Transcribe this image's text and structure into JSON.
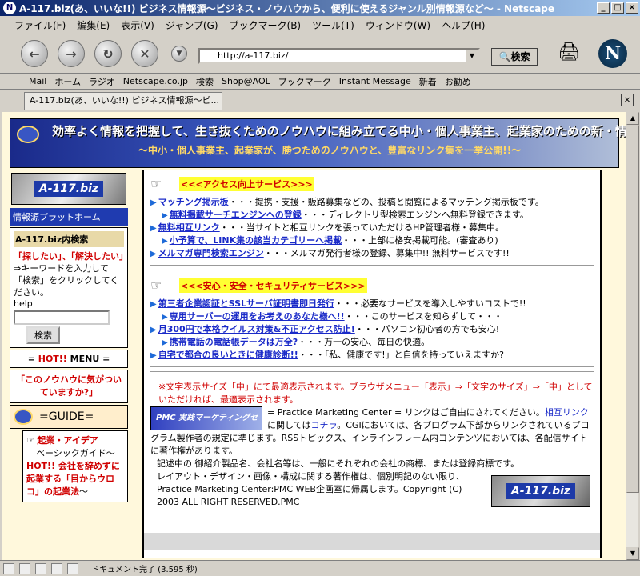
{
  "window": {
    "title": "A-117.biz(あ、いいな!!) ビジネス情報源～ビジネス・ノウハウから、便利に使えるジャンル別情報源など～ - Netscape",
    "app_icon": "N"
  },
  "menu": [
    "ファイル(F)",
    "編集(E)",
    "表示(V)",
    "ジャンプ(G)",
    "ブックマーク(B)",
    "ツール(T)",
    "ウィンドウ(W)",
    "ヘルプ(H)"
  ],
  "nav": {
    "url": "http://a-117.biz/",
    "search_label": "検索"
  },
  "bookmarks": [
    "Mail",
    "ホーム",
    "ラジオ",
    "Netscape.co.jp",
    "検索",
    "Shop@AOL",
    "ブックマーク",
    "Instant Message",
    "新着",
    "お勧め"
  ],
  "tab": {
    "label": "A-117.biz(あ、いいな!!) ビジネス情報源～ビ..."
  },
  "banner": {
    "line1": "効率よく情報を把握して、生き抜くためのノウハウに組み立てる中小・個人事業主、起業家のための新・情報入手ガイド",
    "line2": "～中小・個人事業主、起業家が、勝つためのノウハウと、豊富なリンク集を一挙公開!!～"
  },
  "sidebar": {
    "logo": "A-117.biz",
    "header": "情報源プラットホーム",
    "search_title": "A-117.biz内検索",
    "search_red": "「探したい」、「解決したい」",
    "search_desc": "⇒キーワードを入力して「検索」をクリックしてください。",
    "help": "help",
    "search_button": "検索",
    "hot_prefix": "= ",
    "hot_red": "HOT!!",
    "hot_rest": " MENU =",
    "notice": "「このノウハウに気がついていますか?」",
    "guide": "=GUIDE=",
    "kigyo_title": "起業・アイデア",
    "basic_guide": "ベーシックガイド～",
    "basic_hot": "HOT!! 会社を辞めずに起業する「目からウロコ」の起業法",
    "basic_tail": "～"
  },
  "sections": [
    {
      "title": "<<<アクセス向上サービス>>>",
      "items": [
        {
          "link": "マッチング掲示板",
          "desc": "・・・提携・支援・販路募集などの、投稿と閲覧によるマッチング掲示板です。",
          "indent": false
        },
        {
          "link": "無料掲載サーチエンジンへの登録",
          "desc": "・・・ディレクトリ型検索エンジンへ無料登録できます。",
          "indent": true
        },
        {
          "link": "無料相互リンク",
          "desc": "・・・当サイトと相互リンクを張っていただけるHP管理者様・募集中。",
          "indent": false
        },
        {
          "link": "小予算で、LINK集の該当カテゴリーへ掲載",
          "desc": "・・・上部に格安掲載可能。(審査あり)",
          "indent": true
        },
        {
          "link": "メルマガ専門検索エンジン",
          "desc": "・・・メルマガ発行者様の登録、募集中!! 無料サービスです!!",
          "indent": false
        }
      ]
    },
    {
      "title": "<<<安心・安全・セキュリティサービス>>>",
      "items": [
        {
          "link": "第三者企業認証とSSLサーバ証明書即日発行",
          "desc": "・・・必要なサービスを導入しやすいコストで!!",
          "indent": false
        },
        {
          "link": "専用サーバーの運用をお考えのあなた様へ!!",
          "desc": "・・・このサービスを知らずして・・・",
          "indent": true
        },
        {
          "link": "月300円で本格ウイルス対策&不正アクセス防止!",
          "desc": "・・・パソコン初心者の方でも安心!",
          "indent": false
        },
        {
          "link": "携帯電話の電話帳データは万全?",
          "desc": "・・・万一の安心、毎日の快適。",
          "indent": true
        },
        {
          "link": "自宅で都合の良いときに健康診断!!",
          "desc": "・・・「私、健康です!」と自信を持っていえますか?",
          "indent": false
        }
      ]
    }
  ],
  "footer": {
    "note": "※文字表示サイズ「中」にて最適表示されます。ブラウザメニュー「表示」⇒「文字のサイズ」⇒「中」としていただければ、最適表示されます。",
    "pmc_logo": "PMC 実践マーケティングセンター",
    "para1a": "= Practice Marketing Center = リンクはご自由にされてください。",
    "para1_link": "相互リンク",
    "para1b": "に関しては",
    "para1_link2": "コチラ",
    "para1c": "。CGIにおいては、各プログラム下部からリンクされているプログラム製作者の規定に準じます。RSSトピックス、インラインフレーム内コンテンツにおいては、各配信サイトに著作権があります。",
    "para2": "記述中の 御紹介製品名、会社名等は、一般にそれぞれの会社の商標、または登録商標です。",
    "para3": "レイアウト・デザイン・画像・構成に関する著作権は、個別明記のない限り、Practice Marketing Center:PMC WEB企画室に帰属します。Copyright (C) 2003 ALL RIGHT RESERVED.PMC",
    "logo": "A-117.biz"
  },
  "status": "ドキュメント完了 (3.595 秒)"
}
